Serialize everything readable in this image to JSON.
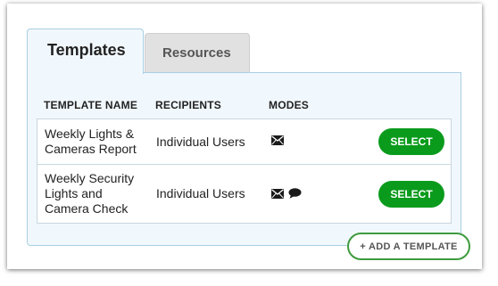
{
  "tabs": [
    {
      "label": "Templates",
      "active": true
    },
    {
      "label": "Resources",
      "active": false
    }
  ],
  "table": {
    "headers": {
      "name": "TEMPLATE NAME",
      "recipients": "RECIPIENTS",
      "modes": "MODES"
    },
    "rows": [
      {
        "name_lines": [
          "Weekly Lights &",
          "Cameras Report"
        ],
        "recipients": "Individual Users",
        "modes": [
          "envelope-icon"
        ],
        "action": "SELECT"
      },
      {
        "name_lines": [
          "Weekly Security",
          "Lights and",
          "Camera Check"
        ],
        "recipients": "Individual Users",
        "modes": [
          "envelope-icon",
          "chat-bubble-icon"
        ],
        "action": "SELECT"
      }
    ]
  },
  "add_template_label": "+ ADD A TEMPLATE",
  "colors": {
    "select_button": "#0a9b1c",
    "add_button_border": "#3e9b3e",
    "panel_background": "#f1f8fd",
    "panel_border": "#a9cfe2"
  }
}
